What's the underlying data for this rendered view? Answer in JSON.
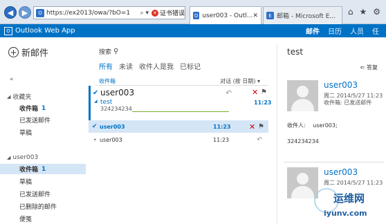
{
  "browser": {
    "url_main": "https://ex2013/owa/?bO=1",
    "search_icon": "search-icon",
    "cert_error": "证书错误",
    "tabs": [
      {
        "label": "user003 - Outl...",
        "active": true
      },
      {
        "label": "邮箱 - Microsoft E...",
        "active": false
      }
    ],
    "toolbar_icons": [
      "home-icon",
      "star-icon",
      "gear-icon"
    ]
  },
  "app": {
    "title": "Outlook Web App",
    "nav": [
      "邮件",
      "日历",
      "人员",
      "任"
    ]
  },
  "sidebar": {
    "new_mail": "新邮件",
    "collapse": "«",
    "favorites": {
      "label": "收藏夹",
      "items": [
        {
          "label": "收件箱",
          "count": "1"
        },
        {
          "label": "已发送邮件"
        },
        {
          "label": "草稿"
        }
      ]
    },
    "account": {
      "label": "user003",
      "items": [
        {
          "label": "收件箱",
          "count": "1"
        },
        {
          "label": "草稿"
        },
        {
          "label": "已发送邮件"
        },
        {
          "label": "已删除的邮件"
        },
        {
          "label": "便笺"
        }
      ]
    }
  },
  "list": {
    "search_label": "搜索",
    "filters": [
      "所有",
      "未读",
      "收件人是我",
      "已标记"
    ],
    "folder": "收件箱",
    "sort": "对话 (按 日期)",
    "thread": {
      "sender": "user003",
      "subject": "test",
      "preview": "324234234",
      "time": "11:23"
    },
    "rows": [
      {
        "sender": "user003",
        "time": "11:23"
      },
      {
        "sender": "user003",
        "time": "11:23"
      }
    ]
  },
  "reading": {
    "subject": "test",
    "reply_all": "答复",
    "message1": {
      "from": "user003",
      "date": "周二 2014/5/27 11:23",
      "folder": "收件箱: 已发送邮件"
    },
    "to_label": "收件人:",
    "to_value": "user003;",
    "body": "324234234",
    "message2": {
      "from": "user003",
      "date": "周二 2014/5/27 11:23"
    }
  },
  "watermark": {
    "cn": "运维网",
    "en": "iyunv.com"
  }
}
